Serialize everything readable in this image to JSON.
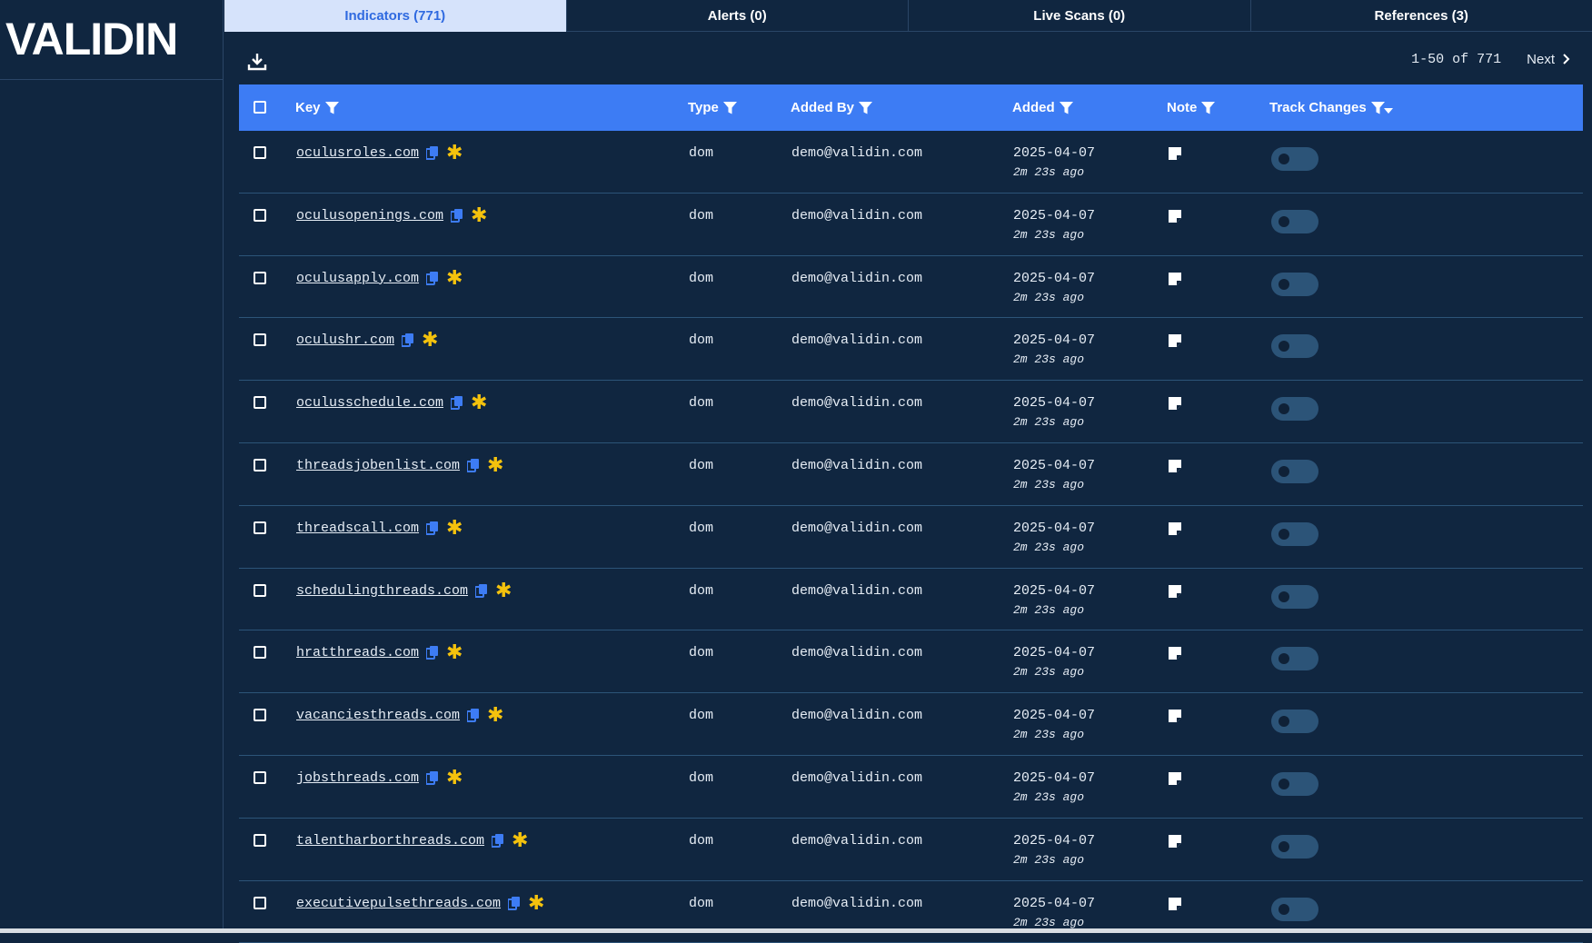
{
  "brand": {
    "logo_text": "VALIDIN"
  },
  "tabs": [
    {
      "label": "Indicators (771)",
      "active": true
    },
    {
      "label": "Alerts (0)"
    },
    {
      "label": "Live Scans (0)"
    },
    {
      "label": "References (3)"
    }
  ],
  "toolbar": {
    "download_icon": "download-icon"
  },
  "pagination": {
    "range": "1-50 of 771",
    "next_label": "Next"
  },
  "table": {
    "columns": {
      "key": "Key",
      "type": "Type",
      "added_by": "Added By",
      "added": "Added",
      "note": "Note",
      "track_changes": "Track Changes"
    },
    "rows": [
      {
        "key": "oculusroles.com",
        "type": "dom",
        "added_by": "demo@validin.com",
        "date": "2025-04-07",
        "ago": "2m 23s ago"
      },
      {
        "key": "oculusopenings.com",
        "type": "dom",
        "added_by": "demo@validin.com",
        "date": "2025-04-07",
        "ago": "2m 23s ago"
      },
      {
        "key": "oculusapply.com",
        "type": "dom",
        "added_by": "demo@validin.com",
        "date": "2025-04-07",
        "ago": "2m 23s ago"
      },
      {
        "key": "oculushr.com",
        "type": "dom",
        "added_by": "demo@validin.com",
        "date": "2025-04-07",
        "ago": "2m 23s ago"
      },
      {
        "key": "oculusschedule.com",
        "type": "dom",
        "added_by": "demo@validin.com",
        "date": "2025-04-07",
        "ago": "2m 23s ago"
      },
      {
        "key": "threadsjobenlist.com",
        "type": "dom",
        "added_by": "demo@validin.com",
        "date": "2025-04-07",
        "ago": "2m 23s ago"
      },
      {
        "key": "threadscall.com",
        "type": "dom",
        "added_by": "demo@validin.com",
        "date": "2025-04-07",
        "ago": "2m 23s ago"
      },
      {
        "key": "schedulingthreads.com",
        "type": "dom",
        "added_by": "demo@validin.com",
        "date": "2025-04-07",
        "ago": "2m 23s ago"
      },
      {
        "key": "hratthreads.com",
        "type": "dom",
        "added_by": "demo@validin.com",
        "date": "2025-04-07",
        "ago": "2m 23s ago"
      },
      {
        "key": "vacanciesthreads.com",
        "type": "dom",
        "added_by": "demo@validin.com",
        "date": "2025-04-07",
        "ago": "2m 23s ago"
      },
      {
        "key": "jobsthreads.com",
        "type": "dom",
        "added_by": "demo@validin.com",
        "date": "2025-04-07",
        "ago": "2m 23s ago"
      },
      {
        "key": "talentharborthreads.com",
        "type": "dom",
        "added_by": "demo@validin.com",
        "date": "2025-04-07",
        "ago": "2m 23s ago"
      },
      {
        "key": "executivepulsethreads.com",
        "type": "dom",
        "added_by": "demo@validin.com",
        "date": "2025-04-07",
        "ago": "2m 23s ago"
      }
    ]
  },
  "colors": {
    "background": "#102640",
    "header_bar": "#3d7cf4",
    "active_tab": "#d6e3fb",
    "star": "#f4c20d",
    "copy_icon": "#3d7cf4"
  }
}
